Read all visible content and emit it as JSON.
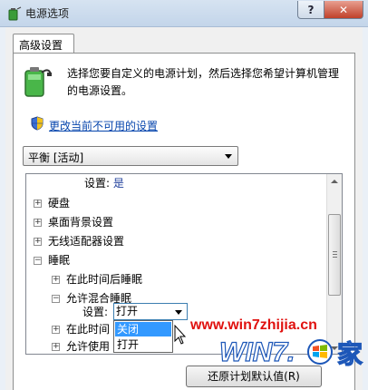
{
  "window": {
    "title": "电源选项",
    "help_label": "?",
    "close_label": "✕"
  },
  "tab": {
    "label": "高级设置"
  },
  "description": "选择您要自定义的电源计划，然后选择您希望计算机管理的电源设置。",
  "change_link": "更改当前不可用的设置",
  "plan_select": {
    "selected": "平衡 [活动]"
  },
  "tree": {
    "rows": [
      {
        "label": "设置:",
        "value": "是"
      },
      {
        "label": "硬盘"
      },
      {
        "label": "桌面背景设置"
      },
      {
        "label": "无线适配器设置"
      },
      {
        "label": "睡眠"
      },
      {
        "label": "在此时间后睡眠"
      },
      {
        "label": "允许混合睡眠"
      },
      {
        "label": "设置:"
      },
      {
        "label": "在此时间"
      },
      {
        "label": "允许使用"
      }
    ],
    "expand_plus": "+",
    "expand_minus": "−"
  },
  "hybrid_sleep_combo": {
    "selected": "打开",
    "options": [
      "关闭",
      "打开"
    ]
  },
  "restore_button": "还原计划默认值(R)",
  "watermark": {
    "url": "www.win7zhijia.cn",
    "logo_text": "WIN7.",
    "logo_char": "家"
  },
  "colors": {
    "link": "#0645ad",
    "value": "#1f3f9b",
    "selection": "#3399ff",
    "close_button": "#c0412a",
    "watermark": "#e0110f"
  }
}
